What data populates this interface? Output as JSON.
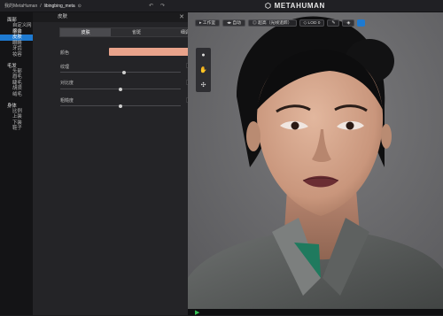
{
  "topbar": {
    "crumb_root": "我的MetaHuman",
    "crumb_sep": "/",
    "crumb_file": "libingbing_meta",
    "crumb_mark": "⊙",
    "undo_icon": "↶",
    "redo_icon": "↷"
  },
  "brand": {
    "logo_icon": "⬡",
    "name": "METAHUMAN"
  },
  "sidebar": {
    "groups": [
      {
        "title": "面部",
        "items": [
          "自定义网格体",
          "混合",
          "皮肤",
          "眼睛",
          "牙齿",
          "妆容"
        ]
      },
      {
        "title": "毛发",
        "items": [
          "头部",
          "眉毛",
          "睫毛",
          "胡须",
          "绒毛"
        ]
      },
      {
        "title": "身体",
        "items": [
          "比例",
          "上装",
          "下装",
          "鞋子"
        ]
      }
    ],
    "active": "皮肤"
  },
  "panel": {
    "title": "皮肤",
    "close_icon": "✕",
    "tabs": [
      "皮肤",
      "雀斑",
      "细调色"
    ],
    "active_tab": "皮肤",
    "color_label": "颜色",
    "color_value": "#e9a38b",
    "texture_label": "纹理",
    "texture_value": "0.5556",
    "texture_level": 0.53,
    "contrast_label": "对比度",
    "contrast_value": "0.00",
    "contrast_level": 0.5,
    "roughness_label": "粗糙度",
    "roughness_value": "0.00",
    "roughness_level": 0.5,
    "arrow_left": "‹",
    "arrow_right": "›"
  },
  "viewport": {
    "toolbar": [
      {
        "icon": "▸",
        "label": "工作室"
      },
      {
        "icon": "◂▸",
        "label": "自动"
      },
      {
        "icon": "◎",
        "label": "超高（光线追踪）"
      },
      {
        "icon": "◇",
        "label": "LOD 0"
      }
    ],
    "rail_icons": [
      "●",
      "✋",
      "✣"
    ],
    "play_icon": "▶"
  },
  "colors": {
    "accent": "#1e7ad1",
    "skin": "#e9a38b"
  }
}
